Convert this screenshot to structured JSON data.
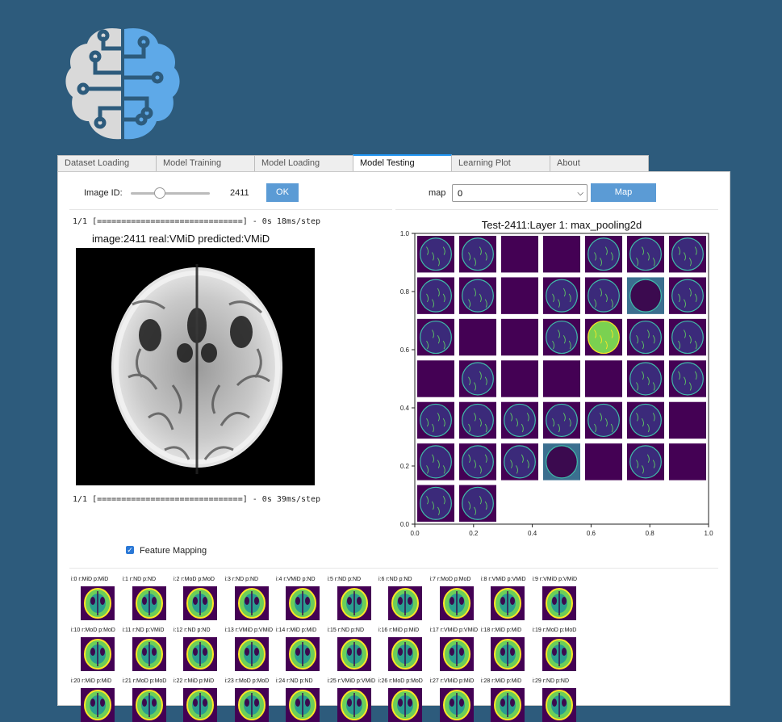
{
  "tabs": [
    "Dataset Loading",
    "Model Training",
    "Model Loading",
    "Model Testing",
    "Learning Plot",
    "About"
  ],
  "active_tab": "Model Testing",
  "controls": {
    "image_id_label": "Image ID:",
    "image_id_value": "2411",
    "ok_label": "OK",
    "map_label": "map",
    "map_selected": "0",
    "map_button": "Map",
    "slider_fraction": 0.35
  },
  "log_lines": {
    "first": "1/1 [==============================] - 0s 18ms/step",
    "second": "1/1 [==============================] - 0s 39ms/step"
  },
  "prediction_title": "image:2411 real:VMiD predicted:VMiD",
  "feature_mapping": {
    "label": "Feature Mapping",
    "checked": true
  },
  "chart_data": {
    "type": "heatmap",
    "title": "Test-2411:Layer 1: max_pooling2d",
    "xlim": [
      0.0,
      1.0
    ],
    "ylim": [
      0.0,
      1.0
    ],
    "x_ticks": [
      "0.0",
      "0.2",
      "0.4",
      "0.6",
      "0.8",
      "1.0"
    ],
    "y_ticks": [
      "0.0",
      "0.2",
      "0.4",
      "0.6",
      "0.8",
      "1.0"
    ],
    "rows": 7,
    "cols": 7,
    "count": 44
  },
  "thumbnails": [
    "i:0 r:MiD p:MiD",
    "i:1 r:ND p:ND",
    "i:2 r:MoD p:MoD",
    "i:3 r:ND p:ND",
    "i:4 r:VMiD p:ND",
    "i:5 r:ND p:ND",
    "i:6 r:ND p:ND",
    "i:7 r:MoD p:MoD",
    "i:8 r:VMiD p:VMiD",
    "i:9 r:VMiD p:VMiD",
    "i:10 r:MoD p:MoD",
    "i:11 r:ND p:VMiD",
    "i:12 r:ND p:ND",
    "i:13 r:VMiD p:VMiD",
    "i:14 r:MiD p:MiD",
    "i:15 r:ND p:ND",
    "i:16 r:MiD p:MiD",
    "i:17 r:VMiD p:VMiD",
    "i:18 r:MiD p:MiD",
    "i:19 r:MoD p:MoD",
    "i:20 r:MiD p:MiD",
    "i:21 r:MoD p:MoD",
    "i:22 r:MiD p:MiD",
    "i:23 r:MoD p:MoD",
    "i:24 r:ND p:ND",
    "i:25 r:VMiD p:VMiD",
    "i:26 r:MoD p:MoD",
    "i:27 r:VMiD p:MiD",
    "i:28 r:MiD p:MiD",
    "i:29 r:ND p:ND"
  ]
}
